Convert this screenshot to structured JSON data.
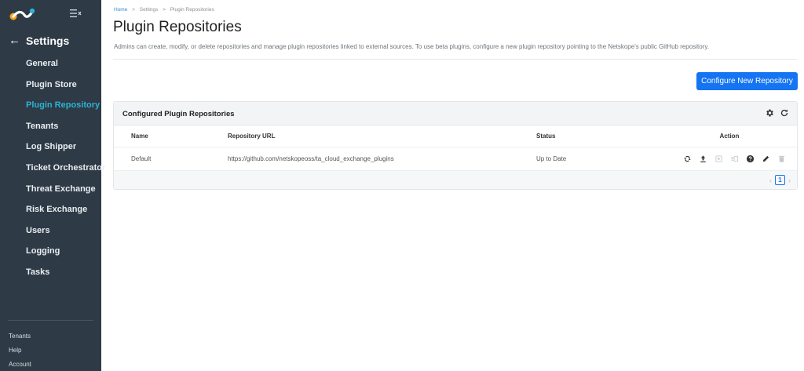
{
  "sidebar": {
    "back_label": "Settings",
    "items": [
      {
        "label": "General",
        "active": false
      },
      {
        "label": "Plugin Store",
        "active": false
      },
      {
        "label": "Plugin Repository",
        "active": true
      },
      {
        "label": "Tenants",
        "active": false
      },
      {
        "label": "Log Shipper",
        "active": false
      },
      {
        "label": "Ticket Orchestrator",
        "active": false
      },
      {
        "label": "Threat Exchange",
        "active": false
      },
      {
        "label": "Risk Exchange",
        "active": false
      },
      {
        "label": "Users",
        "active": false
      },
      {
        "label": "Logging",
        "active": false
      },
      {
        "label": "Tasks",
        "active": false
      }
    ],
    "bottom": [
      {
        "label": "Tenants"
      },
      {
        "label": "Help"
      },
      {
        "label": "Account"
      }
    ]
  },
  "breadcrumb": {
    "home": "Home",
    "settings": "Settings",
    "current": "Plugin Repositories",
    "separator": ">"
  },
  "page": {
    "title": "Plugin Repositories",
    "description": "Admins can create, modify, or delete repositories and manage plugin repositories linked to external sources. To use beta plugins, configure a new plugin repository pointing to the Netskope's public GitHub repository.",
    "configure_button": "Configure New Repository"
  },
  "card": {
    "title": "Configured Plugin Repositories",
    "columns": [
      "Name",
      "Repository URL",
      "Status",
      "Action"
    ],
    "rows": [
      {
        "name": "Default",
        "url": "https://github.com/netskopeoss/ta_cloud_exchange_plugins",
        "status": "Up to Date"
      }
    ],
    "pagination": {
      "current_page": "1"
    }
  },
  "colors": {
    "sidebar_bg": "#2e3a45",
    "active_nav": "#2bb3d6",
    "primary": "#1574f2"
  }
}
